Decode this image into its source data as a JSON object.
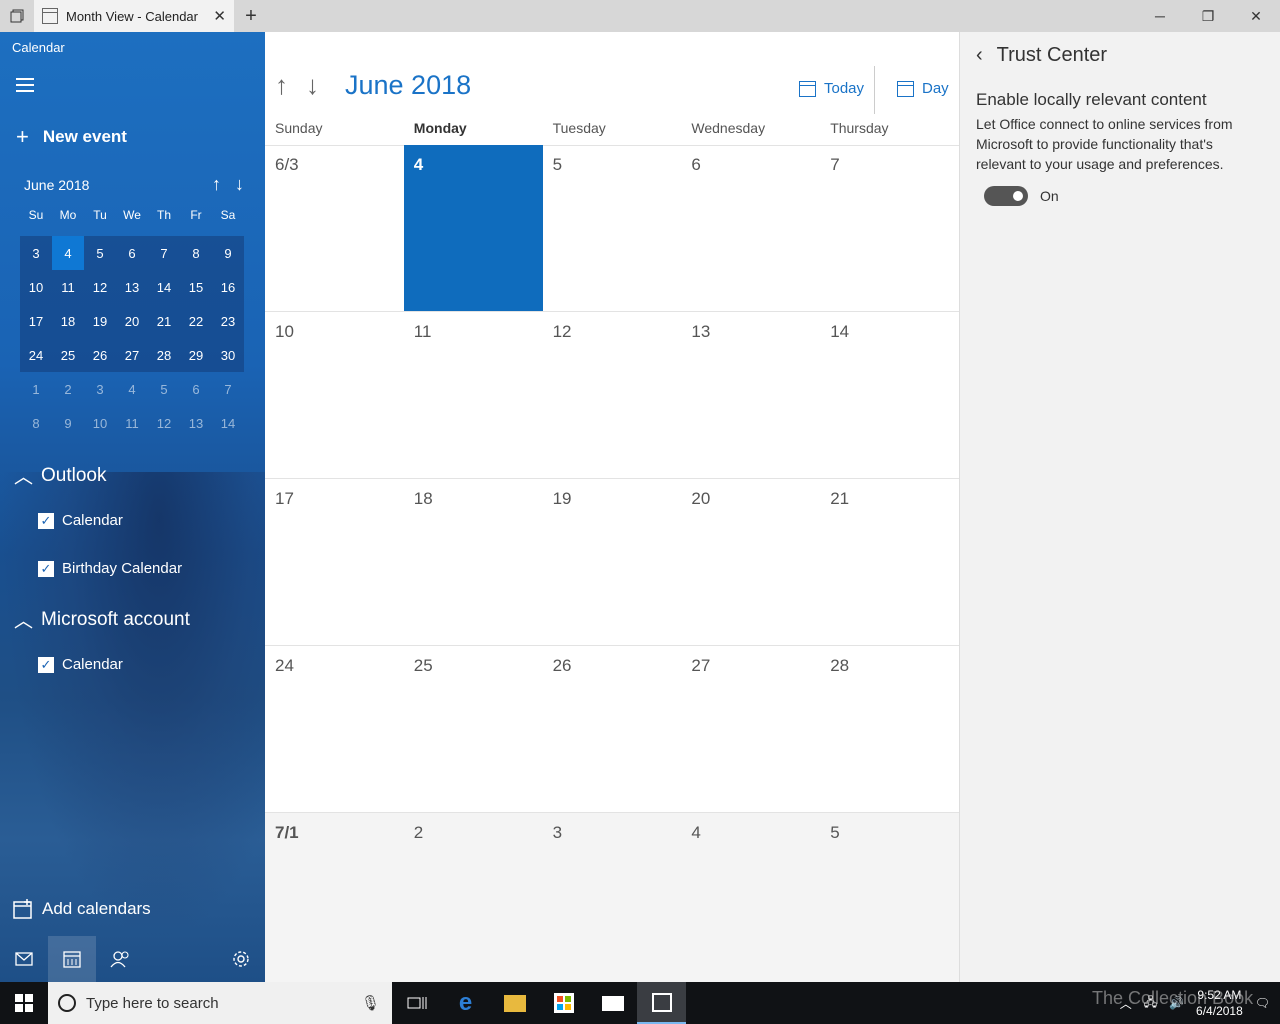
{
  "window": {
    "tab_title": "Month View - Calendar",
    "new_tab_glyph": "+",
    "close_glyph": "✕",
    "minimize_glyph": "─",
    "restore_glyph": "❐",
    "window_close_glyph": "✕"
  },
  "sidebar": {
    "app_title": "Calendar",
    "new_event_label": "New event",
    "mini_month_title": "June 2018",
    "mini_days_header": [
      "Su",
      "Mo",
      "Tu",
      "We",
      "Th",
      "Fr",
      "Sa"
    ],
    "mini_weeks": [
      [
        "3",
        "4",
        "5",
        "6",
        "7",
        "8",
        "9"
      ],
      [
        "10",
        "11",
        "12",
        "13",
        "14",
        "15",
        "16"
      ],
      [
        "17",
        "18",
        "19",
        "20",
        "21",
        "22",
        "23"
      ],
      [
        "24",
        "25",
        "26",
        "27",
        "28",
        "29",
        "30"
      ],
      [
        "1",
        "2",
        "3",
        "4",
        "5",
        "6",
        "7"
      ],
      [
        "8",
        "9",
        "10",
        "11",
        "12",
        "13",
        "14"
      ]
    ],
    "sections": [
      {
        "name": "Outlook",
        "calendars": [
          "Calendar",
          "Birthday Calendar"
        ]
      },
      {
        "name": "Microsoft account",
        "calendars": [
          "Calendar"
        ]
      }
    ],
    "add_calendars_label": "Add calendars",
    "bottom_icons": [
      "mail-icon",
      "calendar-icon",
      "people-icon",
      "gear-icon"
    ]
  },
  "main": {
    "month_title": "June 2018",
    "today_label": "Today",
    "day_label": "Day",
    "weekdays": [
      "Sunday",
      "Monday",
      "Tuesday",
      "Wednesday",
      "Thursday"
    ],
    "selected_weekday": "Monday",
    "weeks": [
      [
        "6/3",
        "4",
        "5",
        "6",
        "7"
      ],
      [
        "10",
        "11",
        "12",
        "13",
        "14"
      ],
      [
        "17",
        "18",
        "19",
        "20",
        "21"
      ],
      [
        "24",
        "25",
        "26",
        "27",
        "28"
      ],
      [
        "7/1",
        "2",
        "3",
        "4",
        "5"
      ]
    ],
    "selected_day": "4"
  },
  "trust_center": {
    "title": "Trust Center",
    "heading": "Enable locally relevant content",
    "description": "Let Office connect to online services from Microsoft to provide functionality that's relevant to your usage and preferences.",
    "toggle_state": "On"
  },
  "taskbar": {
    "search_placeholder": "Type here to search",
    "time": "9:52 AM",
    "date": "6/4/2018",
    "watermark": "The Collection Book"
  },
  "colors": {
    "accent": "#0f6cbd",
    "link": "#1a73c7",
    "sidebar": "#1a63b4"
  }
}
